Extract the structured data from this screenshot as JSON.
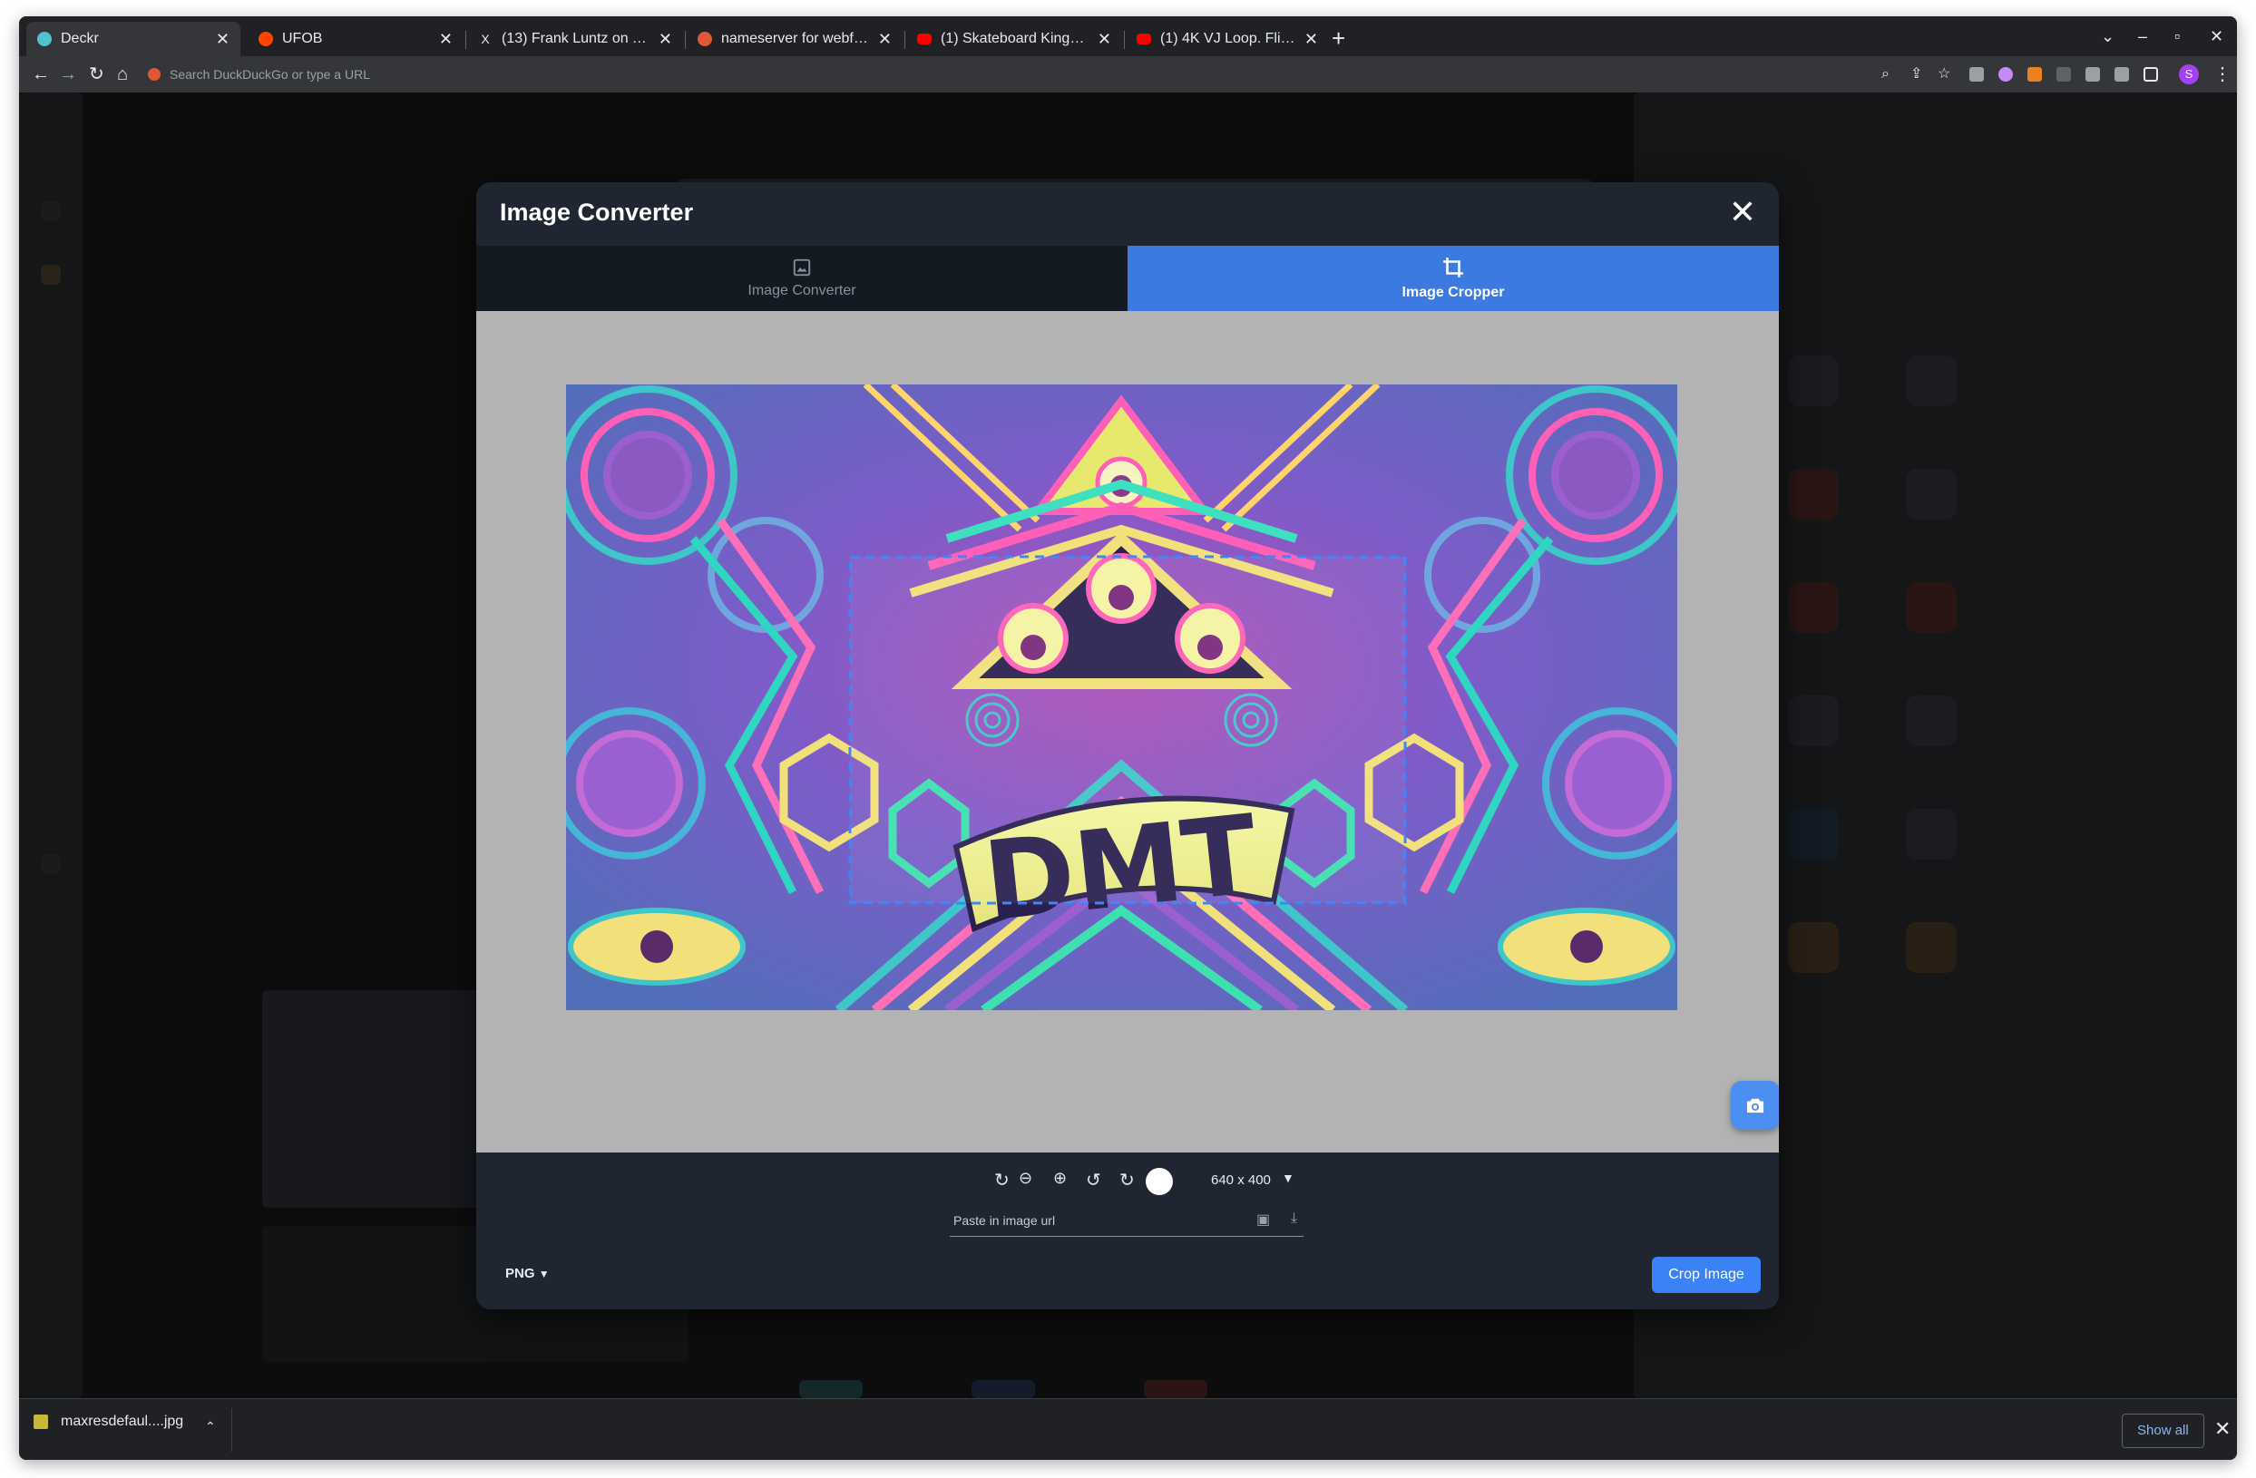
{
  "browser": {
    "tabs": [
      {
        "title": "Deckr",
        "active": true,
        "favicon_color": "#4fc3d0"
      },
      {
        "title": "UFOB",
        "active": false,
        "favicon_color": "#ff4500"
      },
      {
        "title": "(13) Frank Luntz on Twitter",
        "active": false,
        "favicon_color": "#e8eaed"
      },
      {
        "title": "nameserver for webflow",
        "active": false,
        "favicon_color": "#de5833"
      },
      {
        "title": "(1) Skateboard Kings (1978)",
        "active": false,
        "favicon_color": "#ff0000"
      },
      {
        "title": "(1) 4K VJ Loop. Flight in abstract",
        "active": false,
        "favicon_color": "#ff0000"
      }
    ],
    "new_tab": "+",
    "window_controls": {
      "dropdown": "⌄",
      "minimize": "–",
      "maximize": "▫",
      "close": "✕"
    },
    "omnibox_placeholder": "Search DuckDuckGo or type a URL",
    "profile_initial": "S"
  },
  "modal": {
    "title": "Image Converter",
    "tabs": [
      {
        "label": "Image Converter",
        "icon": "image-icon",
        "active": false
      },
      {
        "label": "Image Cropper",
        "icon": "crop-icon",
        "active": true
      }
    ],
    "image_text": "DMT",
    "output_size": "640 x 400",
    "url_placeholder": "Paste in image url",
    "format": "PNG",
    "crop_button": "Crop Image",
    "accent": "#3b82f6"
  },
  "downloads": {
    "file_name": "maxresdefaul....jpg",
    "show_all": "Show all"
  }
}
